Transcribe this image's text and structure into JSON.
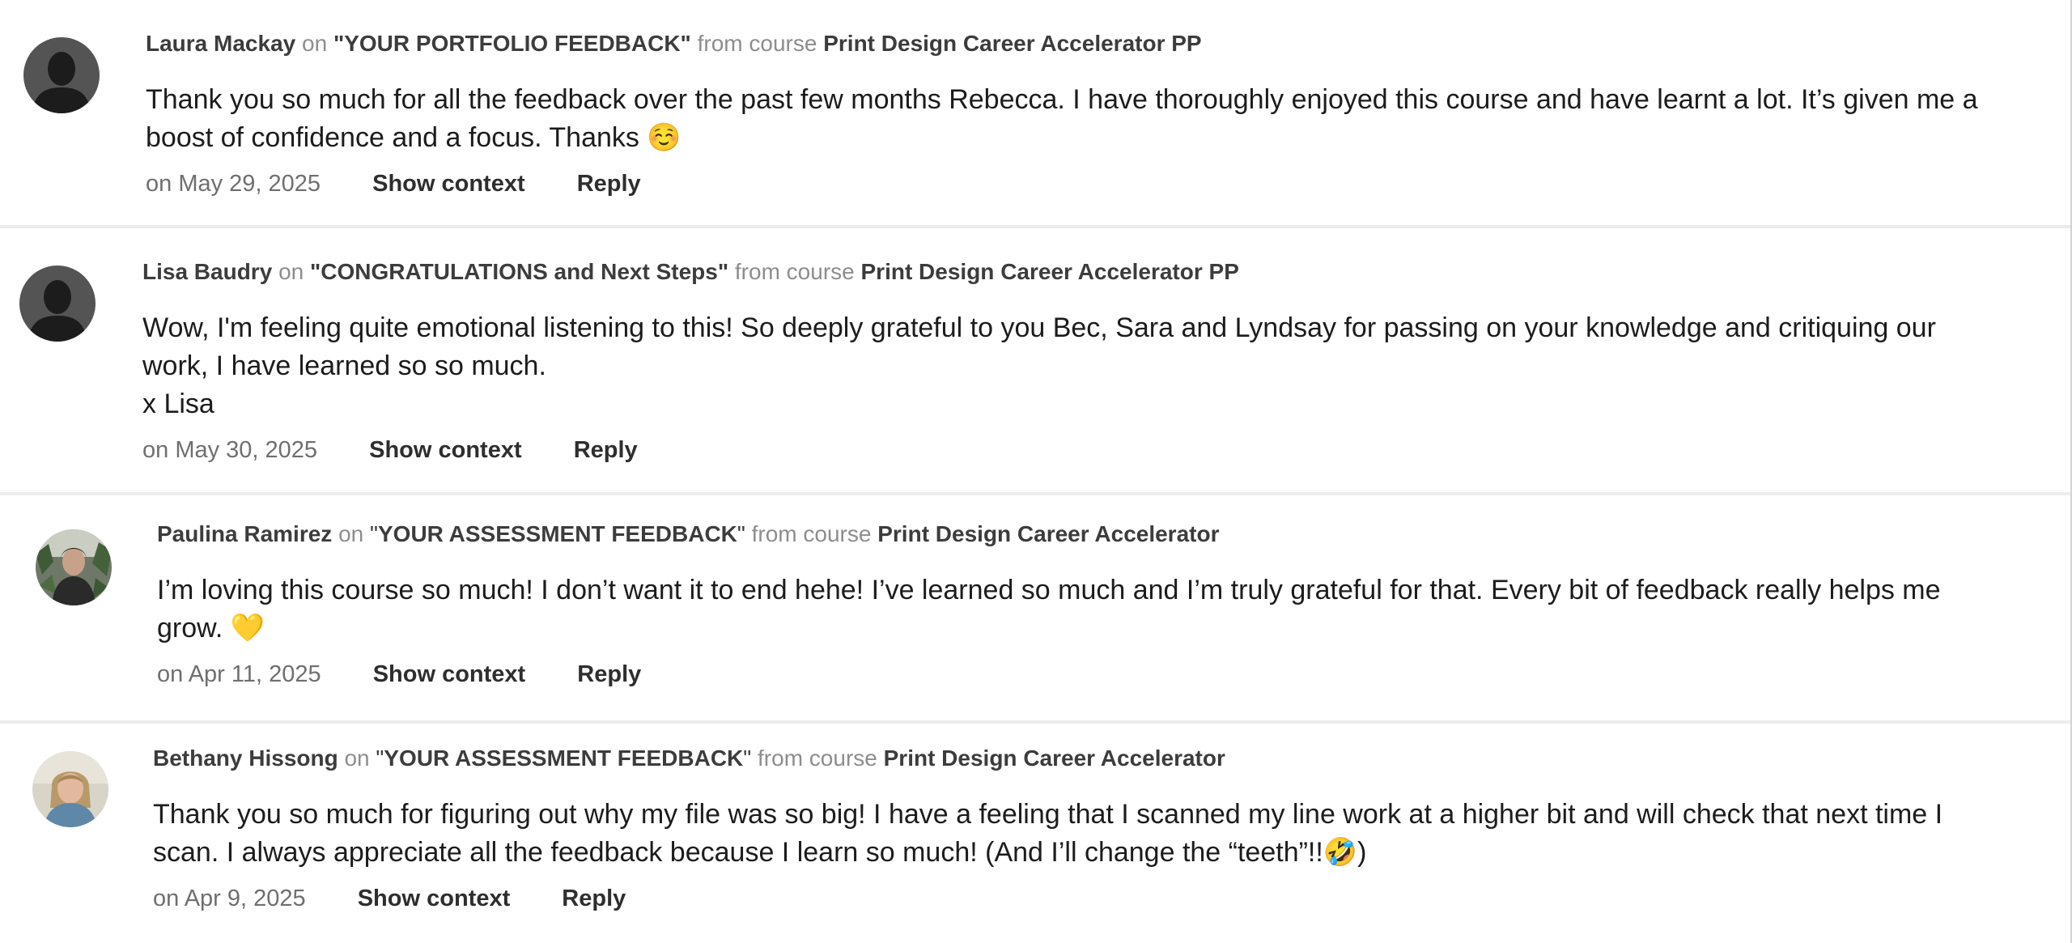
{
  "labels": {
    "on": "on",
    "from_course": "from course",
    "show_context": "Show context",
    "reply": "Reply"
  },
  "comments": [
    {
      "author": "Laura Mackay",
      "lesson": "\"YOUR PORTFOLIO FEEDBACK\"",
      "course": "Print Design Career Accelerator PP",
      "text_lines": [
        "Thank you so much for all the feedback over the past few months Rebecca. I have thoroughly enjoyed this course and have learnt a lot. It’s given me a boost of confidence and a focus. Thanks ☺️"
      ],
      "date": "on May 29, 2025",
      "avatar": "default-silhouette-icon"
    },
    {
      "author": "Lisa Baudry",
      "lesson": "\"CONGRATULATIONS and Next Steps\"",
      "course": "Print Design Career Accelerator PP",
      "text_lines": [
        "Wow, I'm feeling quite emotional listening to this! So deeply grateful to you Bec, Sara and Lyndsay for passing on your knowledge and critiquing our work, I have learned so so much.",
        "x Lisa"
      ],
      "date": "on May 30, 2025",
      "avatar": "default-silhouette-icon"
    },
    {
      "author": "Paulina Ramirez",
      "lesson_open": "\"",
      "lesson_title": "YOUR ASSESSMENT FEEDBACK",
      "lesson_close": "\"",
      "course": "Print Design Career Accelerator",
      "text_lines": [
        "I’m loving this course so much! I don’t want it to end hehe! I’ve learned so much and I’m truly grateful for that. Every bit of feedback really helps me grow. 💛"
      ],
      "date": "on Apr 11, 2025",
      "avatar": "profile-photo"
    },
    {
      "author": "Bethany Hissong",
      "lesson_open": "\"",
      "lesson_title": "YOUR ASSESSMENT FEEDBACK",
      "lesson_close": "\"",
      "course": "Print Design Career Accelerator",
      "text_lines": [
        "Thank you so much for figuring out why my file was so big! I have a feeling that I scanned my line work at a higher bit and will check that next time I scan. I always appreciate all the feedback because I learn so much! (And I’ll change the “teeth”!!🤣)"
      ],
      "date": "on Apr 9, 2025",
      "avatar": "profile-photo"
    }
  ]
}
